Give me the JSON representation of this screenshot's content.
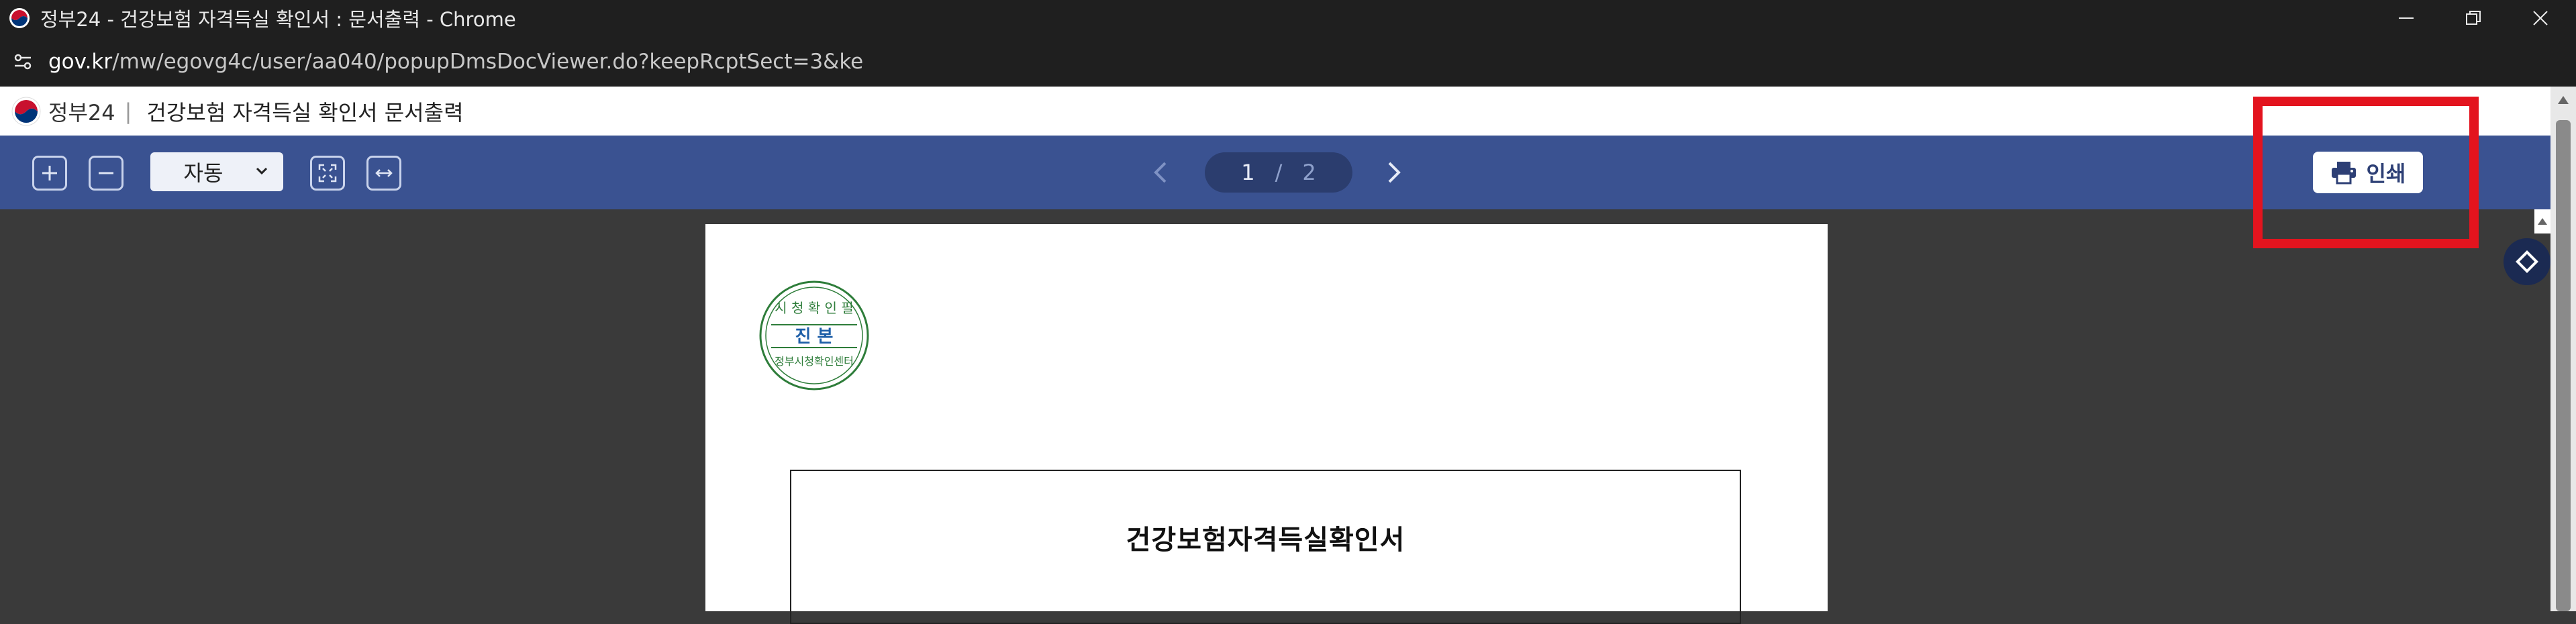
{
  "browser": {
    "window_title": "정부24 - 건강보험 자격득실 확인서 : 문서출력 - Chrome",
    "url_host": "gov.kr",
    "url_path": "/mw/egovg4c/user/aa040/popupDmsDocViewer.do?keepRcptSect=3&ke"
  },
  "header": {
    "brand": "정부24",
    "separator": "|",
    "doc_title": "건강보험 자격득실 확인서 문서출력"
  },
  "toolbar": {
    "zoom_value": "자동",
    "current_page": "1",
    "page_separator": "/",
    "total_pages": "2",
    "print_label": "인쇄"
  },
  "stamp": {
    "top_text": "시 청 확 인 필",
    "center_text": "진 본",
    "bottom_text": "정부시청확인센터"
  },
  "document": {
    "heading": "건강보험자격득실확인서"
  },
  "colors": {
    "toolbar_bg": "#3a5291",
    "highlight": "#e3141e",
    "stamp_green": "#2e7d3a"
  }
}
